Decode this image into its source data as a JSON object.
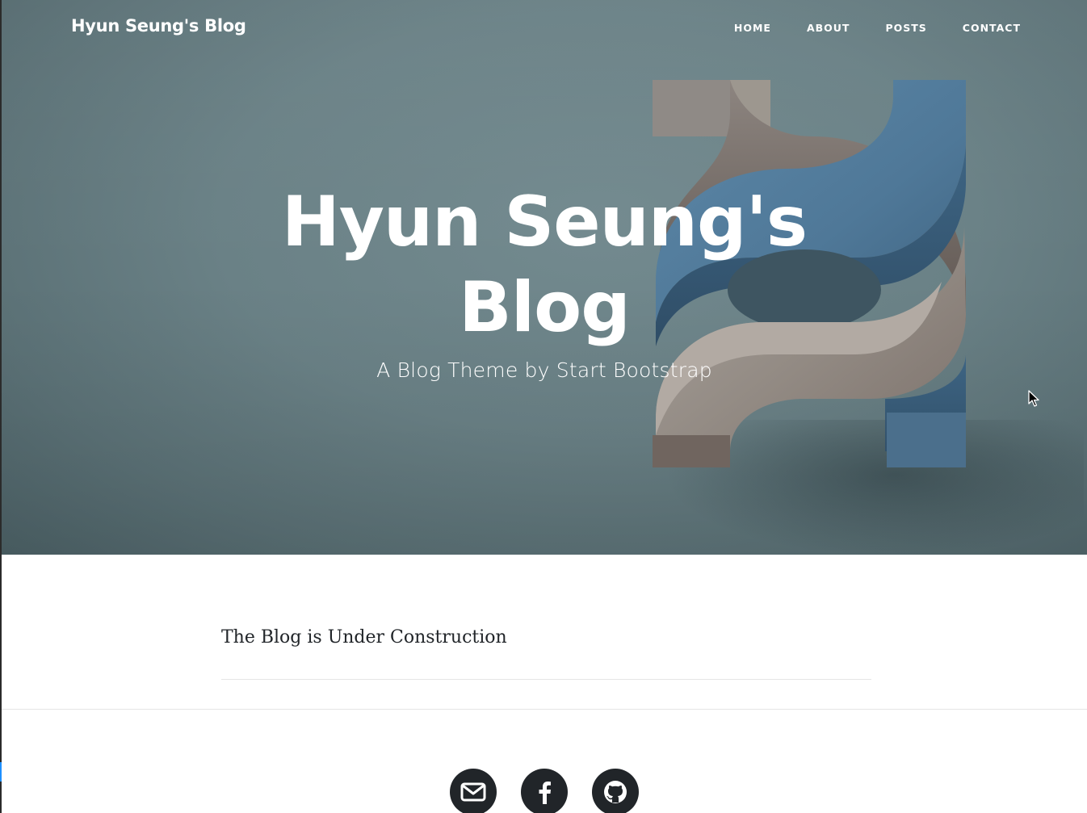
{
  "navbar": {
    "brand": "Hyun Seung's Blog",
    "links": [
      "HOME",
      "ABOUT",
      "POSTS",
      "CONTACT"
    ]
  },
  "hero": {
    "title": "Hyun Seung's Blog",
    "subtitle": "A Blog Theme by Start Bootstrap"
  },
  "posts": [
    {
      "title": "The Blog is Under Construction"
    }
  ],
  "footer": {
    "social": [
      {
        "icon": "envelope-icon"
      },
      {
        "icon": "facebook-icon"
      },
      {
        "icon": "github-icon"
      }
    ]
  },
  "colors": {
    "hero_bg": "#6a8186",
    "text_dark": "#212529",
    "accent_edge": "#1e90ff"
  }
}
